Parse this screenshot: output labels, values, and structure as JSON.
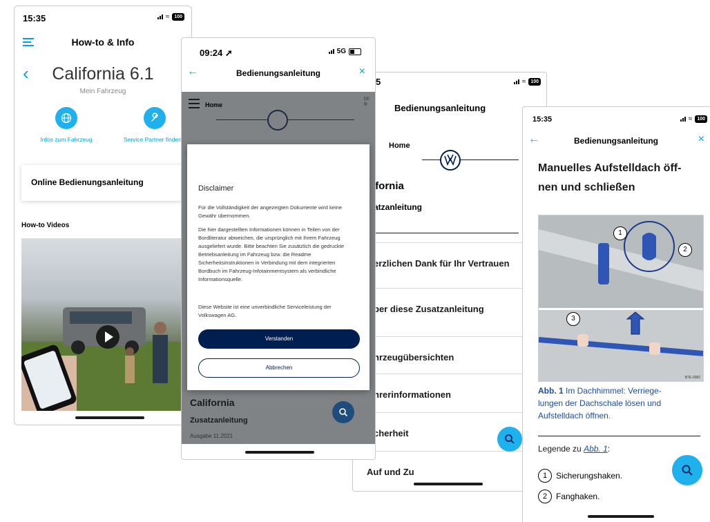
{
  "phone1": {
    "status_time": "15:35",
    "battery": "100",
    "header_title": "How-to & Info",
    "vehicle_name": "California 6.1",
    "vehicle_subtitle": "Mein Fahrzeug",
    "action1_label": "Infos zum Fahrzeug",
    "action2_label": "Service Partner finden",
    "online_manual_label": "Online Bedienungsanleitung",
    "videos_heading": "How-to Videos"
  },
  "phone2": {
    "status_time": "09:24",
    "network": "5G",
    "header_title": "Bedienungsanleitung",
    "home_label": "Home",
    "lang_label": "DE",
    "dialog_title": "Disclaimer",
    "dialog_p1": "Für die Vollständigkeit der angezeigten Dokumente wird keine Gewähr übernommen.",
    "dialog_p2": "Die hier dargestellten Informationen können in Teilen von der Bordliteratur abweichen, die ursprünglich mit Ihrem Fahrzeug ausgeliefert wurde. Bitte beachten Sie zusätzlich die gedruckte Betriebsanleitung im Fahrzeug bzw. die Readme Sicherheitsinstruktionen in Verbindung mit dem integrierten Bordbuch im Fahrzeug-Infotainmentsystem als verbindliche Informationsquelle.",
    "dialog_p3": "Diese Website ist eine unverbindliche Serviceleistung der Volkswagen AG.",
    "confirm_label": "Verstanden",
    "cancel_label": "Abbrechen",
    "bg_title": "California",
    "bg_subtitle": "Zusatzanleitung",
    "bg_edition": "Ausgabe 11.2021"
  },
  "phone3": {
    "status_time": "5",
    "header_title": "Bedienungsanleitung",
    "home_label": "Home",
    "title": "ifornia",
    "subtitle": "atzanleitung",
    "items": [
      {
        "label": "erzlichen Dank für Ihr Vertrauen"
      },
      {
        "label": "ber diese Zusatzanleitung"
      },
      {
        "label": "hrzeugübersichten"
      },
      {
        "label": "hrerinformationen"
      },
      {
        "label": "cherheit"
      },
      {
        "label": "Auf und Zu"
      }
    ]
  },
  "phone4": {
    "status_time": "15:35",
    "header_title": "Bedienungsanleitung",
    "heading": "Manuelles Aufstelldach öff-nen und schließen",
    "heading_line1": "Manuelles Aufstelldach öff-",
    "heading_line2": "nen und schließen",
    "figure_code": "B7E-0382",
    "callouts": [
      "1",
      "2",
      "3"
    ],
    "caption_label": "Abb. 1",
    "caption_line1": " Im Dachhimmel: Verriege-",
    "caption_line2": "lungen der Dachschale lösen und",
    "caption_line3": "Aufstelldach öffnen.",
    "legend_prefix": "Legende zu ",
    "legend_link": "Abb. 1",
    "legend_suffix": ":",
    "legend_items": [
      {
        "num": "1",
        "label": "Sicherungshaken."
      },
      {
        "num": "2",
        "label": "Fanghaken."
      }
    ]
  }
}
